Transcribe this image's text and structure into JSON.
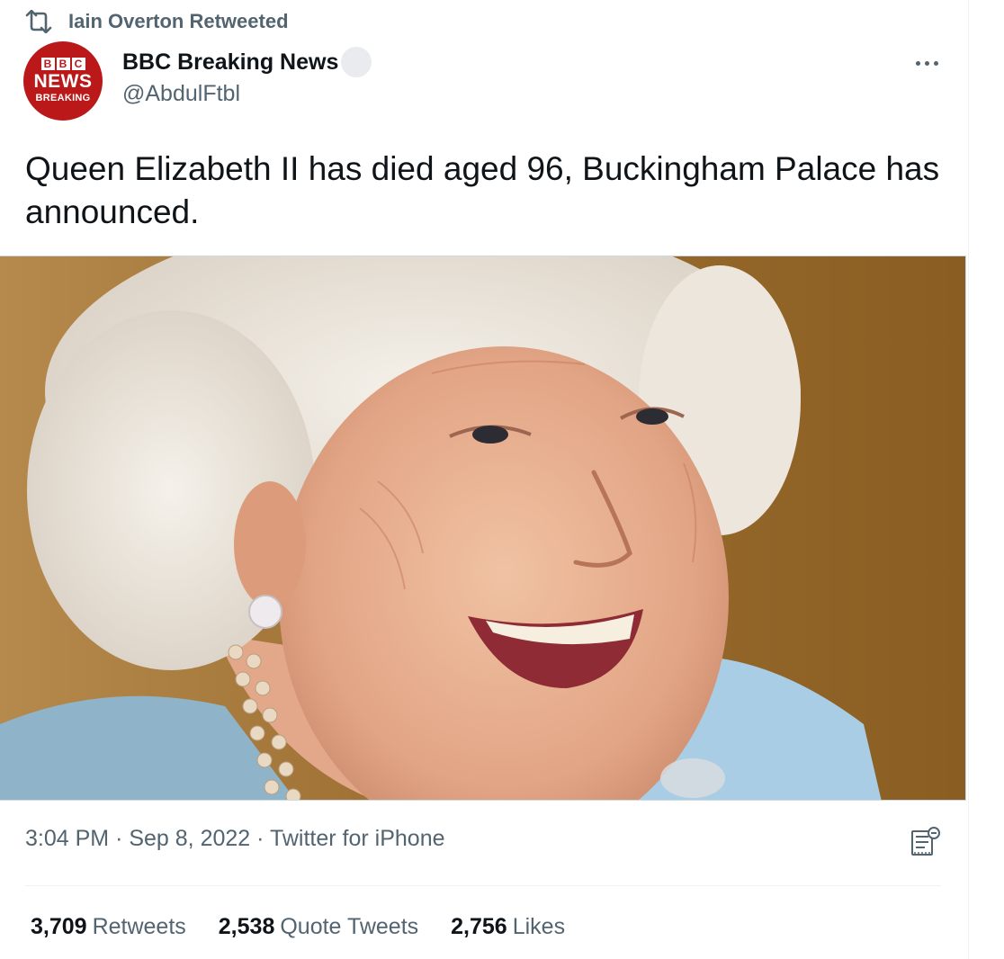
{
  "retweet_banner": {
    "text": "Iain Overton Retweeted",
    "icon": "retweet-icon"
  },
  "author": {
    "display_name": "BBC Breaking News",
    "handle": "@AbdulFtbl",
    "avatar": {
      "bbc_letters": [
        "B",
        "B",
        "C"
      ],
      "line1": "NEWS",
      "line2": "BREAKING",
      "background": "#bb1919"
    },
    "verified_badge_icon": "verified-badge-icon"
  },
  "more_icon": "more-icon",
  "tweet": {
    "text": "Queen Elizabeth II has died aged 96, Buckingham Palace has announced.",
    "photo_icon": "photo"
  },
  "meta": {
    "time": "3:04 PM",
    "separator": "·",
    "date": "Sep 8, 2022",
    "source": "Twitter for iPhone",
    "analytics_icon": "analytics-icon"
  },
  "stats": [
    {
      "count": "3,709",
      "label": "Retweets"
    },
    {
      "count": "2,538",
      "label": "Quote Tweets"
    },
    {
      "count": "2,756",
      "label": "Likes"
    }
  ],
  "colors": {
    "text_primary": "#0f1419",
    "text_secondary": "#536471",
    "bbc_red": "#bb1919",
    "border": "#cfd9de"
  }
}
